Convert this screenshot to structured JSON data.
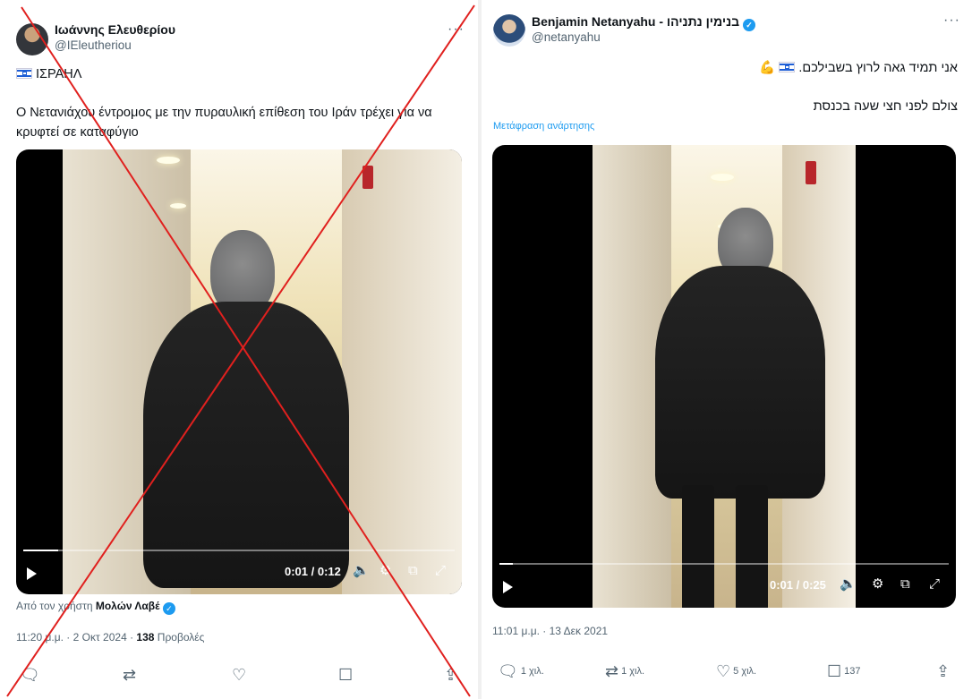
{
  "left_post": {
    "author_name": "Ιωάννης Ελευθερίου",
    "handle": "@IEleutheriou",
    "more": "···",
    "location_tag": "ΙΣΡΑΗΛ",
    "body": "Ο Νετανιάχου έντρομος  με την πυραυλική επίθεση του Ιράν τρέχει για να κρυφτεί σε καταφύγιο",
    "video": {
      "time": "0:01 / 0:12",
      "progress": 0.08
    },
    "source_prefix": "Από τον χρήστη",
    "source_user": "Μολών Λαβέ",
    "time_date": "11:20 μ.μ. · 2 Οκτ 2024 ·",
    "views_count": "138",
    "views_label": "Προβολές",
    "actions": {
      "reply": "",
      "repost": "",
      "like": "",
      "bookmark": "",
      "share": ""
    }
  },
  "right_post": {
    "author_name": "Benjamin Netanyahu - בנימין נתניהו",
    "handle": "@netanyahu",
    "more": "···",
    "line1": "אני תמיד גאה לרוץ בשבילכם.",
    "line2": "צולם לפני חצי שעה בכנסת",
    "translate": "Μετάφραση ανάρτησης",
    "video": {
      "time": "0:01 / 0:25",
      "progress": 0.03
    },
    "time_date": "11:01 μ.μ. · 13 Δεκ 2021",
    "actions": {
      "reply": "1 χιλ.",
      "repost": "1 χιλ.",
      "like": "5 χιλ.",
      "bookmark": "137",
      "share": ""
    }
  },
  "colors": {
    "accent": "#1d9bf0",
    "cross": "#e0201e",
    "muted": "#536471"
  },
  "icons": [
    "verified-badge-icon",
    "israel-flag-icon",
    "flexed-arm-emoji-icon",
    "play-icon",
    "volume-icon",
    "settings-icon",
    "pip-icon",
    "fullscreen-icon",
    "reply-icon",
    "repost-icon",
    "like-icon",
    "bookmark-icon",
    "share-icon"
  ]
}
